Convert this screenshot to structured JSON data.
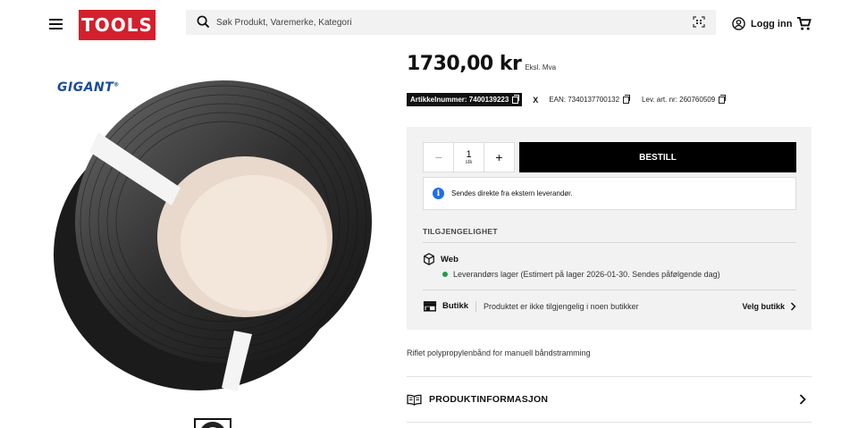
{
  "header": {
    "logo_text": "TOOLS",
    "search_placeholder": "Søk Produkt, Varemerke, Kategori",
    "login_label": "Logg inn"
  },
  "product": {
    "brand": "GIGANT",
    "price": "1730,00 kr",
    "vat_note": "Eksl. Mva",
    "article_number": "Artikkelnummer: 7400139223",
    "separator": "X",
    "ean": "EAN: 7340137700132",
    "supplier_article": "Lev. art. nr: 260760509",
    "description": "Riflet polypropylenbånd for manuell båndstramming"
  },
  "order": {
    "quantity": "1",
    "unit": "stk",
    "minus": "−",
    "plus": "+",
    "order_label": "BESTILL",
    "info_icon": "i",
    "info_text": "Sendes direkte fra ekstern leverandør."
  },
  "availability": {
    "title": "TILGJENGELIGHET",
    "web_label": "Web",
    "web_stock": "Leverandørs lager (Estimert på lager 2026-01-30. Sendes påfølgende dag)",
    "store_label": "Butikk",
    "store_message": "Produktet er ikke tilgjengelig i noen butikker",
    "store_action": "Velg butikk"
  },
  "sections": {
    "product_info": "PRODUKTINFORMASJON"
  },
  "colors": {
    "brand_red": "#d4202d",
    "info_blue": "#1f6fe5",
    "stock_green": "#1e9e4a"
  }
}
